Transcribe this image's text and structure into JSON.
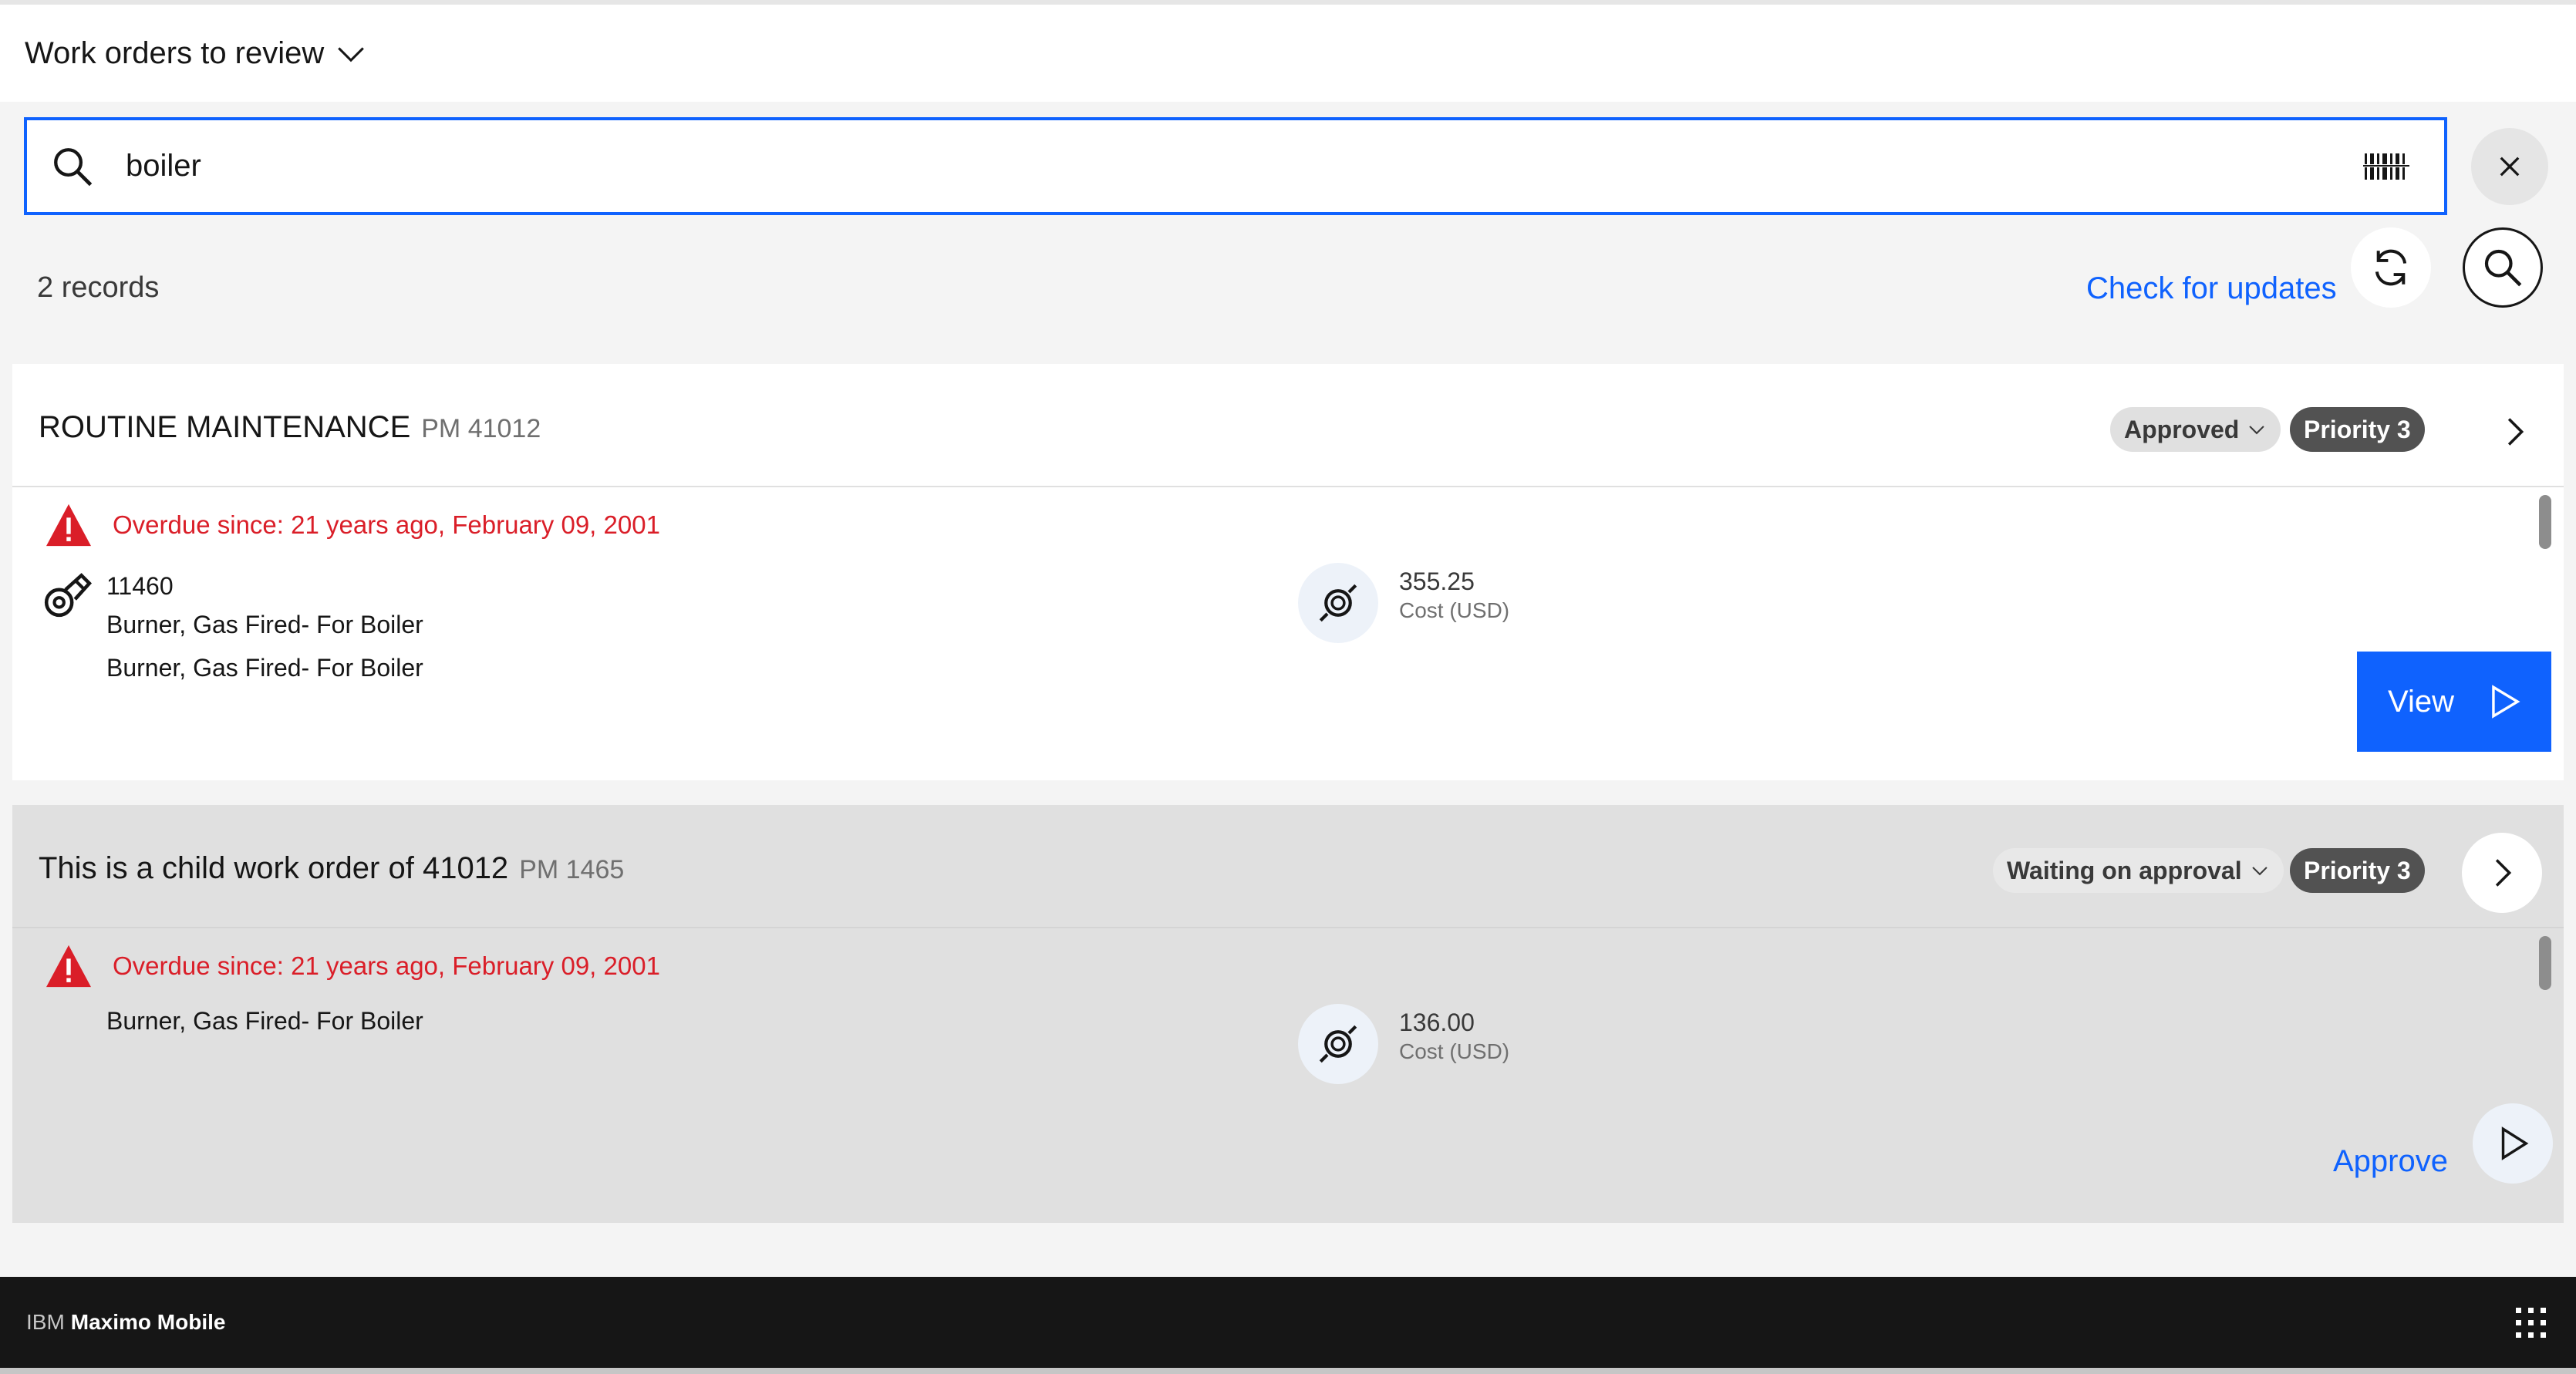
{
  "header": {
    "title": "Work orders to review",
    "chevron_icon": "chevron-down-icon"
  },
  "search": {
    "value": "boiler",
    "placeholder": "Search",
    "icons": [
      "search-icon",
      "barcode-icon",
      "close-icon"
    ]
  },
  "toolbar": {
    "records_count": "2 records",
    "check_updates_label": "Check for updates"
  },
  "colors": {
    "accent": "#0f62fe",
    "danger": "#da1e28",
    "footer_bg": "#161616",
    "priority_tag": "#525252"
  },
  "work_orders": [
    {
      "title": "ROUTINE MAINTENANCE",
      "pm": "PM 41012",
      "status": "Approved",
      "priority": "Priority 3",
      "overdue": "Overdue since: 21 years ago, February 09, 2001",
      "asset_number": "11460",
      "asset_description": "Burner, Gas Fired- For Boiler",
      "description": "Burner, Gas Fired- For Boiler",
      "cost_value": "355.25",
      "cost_label": "Cost (USD)",
      "action_label": "View"
    },
    {
      "title": "This is a child work order of 41012",
      "pm": "PM 1465",
      "status": "Waiting on approval",
      "priority": "Priority 3",
      "overdue": "Overdue since: 21 years ago, February 09, 2001",
      "description": "Burner, Gas Fired- For Boiler",
      "cost_value": "136.00",
      "cost_label": "Cost (USD)",
      "action_label": "Approve"
    }
  ],
  "footer": {
    "brand_prefix": "IBM",
    "brand_name": "Maximo Mobile",
    "menu_icon": "app-switcher-grid-icon"
  }
}
